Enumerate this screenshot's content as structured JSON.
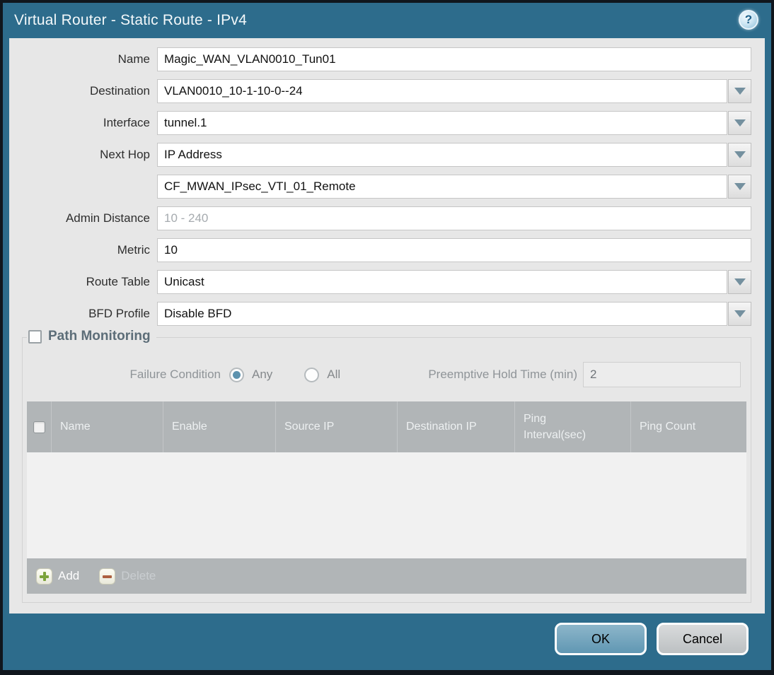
{
  "titlebar": {
    "title": "Virtual Router - Static Route - IPv4",
    "help_glyph": "?"
  },
  "form": {
    "name": {
      "label": "Name",
      "value": "Magic_WAN_VLAN0010_Tun01"
    },
    "destination": {
      "label": "Destination",
      "value": "VLAN0010_10-1-10-0--24"
    },
    "interface": {
      "label": "Interface",
      "value": "tunnel.1"
    },
    "next_hop": {
      "label": "Next Hop",
      "value": "IP Address"
    },
    "next_hop_address": {
      "value": "CF_MWAN_IPsec_VTI_01_Remote"
    },
    "admin_distance": {
      "label": "Admin Distance",
      "placeholder": "10 - 240"
    },
    "metric": {
      "label": "Metric",
      "value": "10"
    },
    "route_table": {
      "label": "Route Table",
      "value": "Unicast"
    },
    "bfd_profile": {
      "label": "BFD Profile",
      "value": "Disable BFD"
    }
  },
  "path_monitoring": {
    "title": "Path Monitoring",
    "checked": false,
    "failure_condition": {
      "label": "Failure Condition",
      "options": [
        {
          "label": "Any",
          "selected": true
        },
        {
          "label": "All",
          "selected": false
        }
      ]
    },
    "preemptive_hold_time": {
      "label": "Preemptive Hold Time (min)",
      "value": "2"
    },
    "table": {
      "columns": [
        "Name",
        "Enable",
        "Source IP",
        "Destination IP",
        "Ping Interval(sec)",
        "Ping Count"
      ],
      "rows": []
    },
    "actions": {
      "add": "Add",
      "delete": "Delete",
      "delete_enabled": false
    }
  },
  "footer": {
    "ok": "OK",
    "cancel": "Cancel"
  },
  "colors": {
    "titlebar_teal": "#2d6c8c",
    "content_bg": "#e7e7e7",
    "table_header_gray": "#b1b5b7",
    "ok_button_blue": "#6097b3",
    "radio_selected_blue": "#5d92ae",
    "add_icon_green": "#7ca33b",
    "delete_icon_red": "#ad6040",
    "outer_border": "#10161d"
  }
}
